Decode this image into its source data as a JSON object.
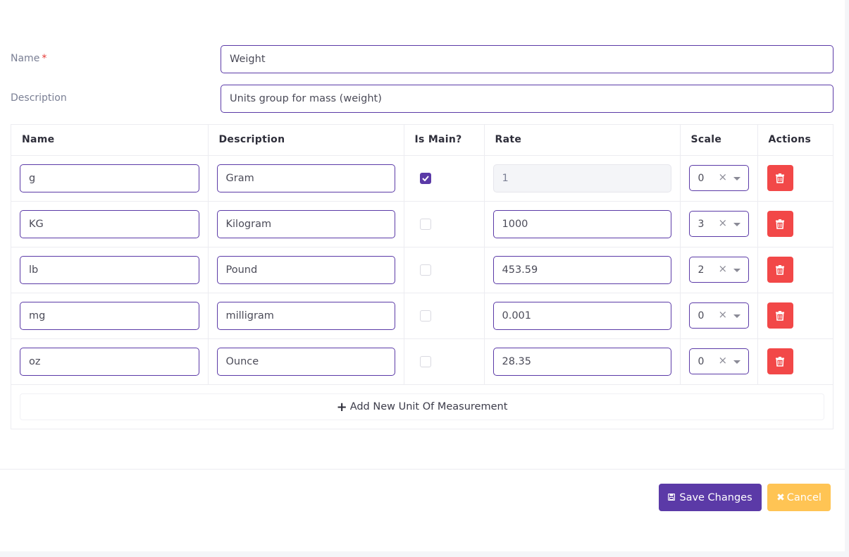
{
  "form": {
    "name_label": "Name",
    "required_mark": "*",
    "name_value": "Weight",
    "description_label": "Description",
    "description_value": "Units group for mass (weight)"
  },
  "table": {
    "headers": [
      "Name",
      "Description",
      "Is Main?",
      "Rate",
      "Scale",
      "Actions"
    ],
    "rows": [
      {
        "name": "g",
        "description": "Gram",
        "is_main": true,
        "rate": "1",
        "scale": "0"
      },
      {
        "name": "KG",
        "description": "Kilogram",
        "is_main": false,
        "rate": "1000",
        "scale": "3"
      },
      {
        "name": "lb",
        "description": "Pound",
        "is_main": false,
        "rate": "453.59",
        "scale": "2"
      },
      {
        "name": "mg",
        "description": "milligram",
        "is_main": false,
        "rate": "0.001",
        "scale": "0"
      },
      {
        "name": "oz",
        "description": "Ounce",
        "is_main": false,
        "rate": "28.35",
        "scale": "0"
      }
    ],
    "scale_clear_glyph": "×",
    "delete_icon": "trash-icon",
    "add_row_label": "Add New Unit Of Measurement",
    "add_row_icon": "plus-icon"
  },
  "footer": {
    "save_label": "Save Changes",
    "save_icon": "floppy-disk-icon",
    "cancel_label": "Cancel",
    "cancel_icon": "close-icon"
  },
  "colors": {
    "primary": "#5b3aa7",
    "danger": "#f24848",
    "warning": "#ffc454",
    "required": "#e53935"
  }
}
